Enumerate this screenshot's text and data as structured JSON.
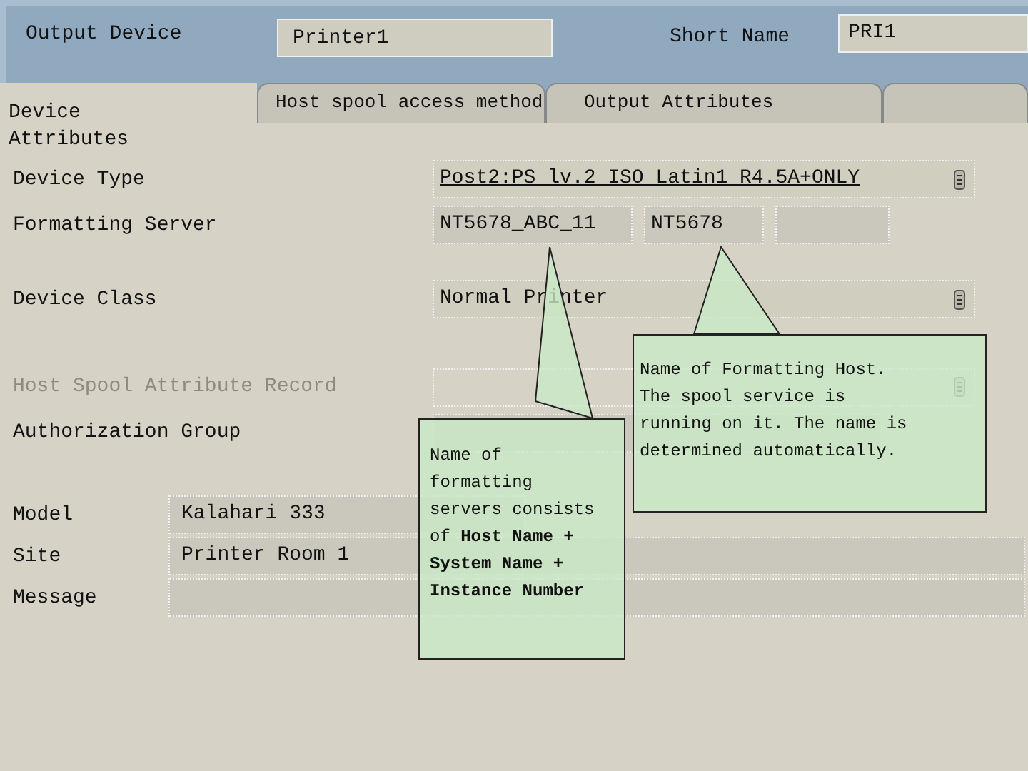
{
  "header": {
    "output_device_label": "Output Device",
    "output_device_value": "Printer1",
    "short_name_label": "Short Name",
    "short_name_value": "PRI1"
  },
  "tabs": [
    {
      "label": "Device Attributes",
      "selected": true
    },
    {
      "label": "Host spool access method",
      "selected": false
    },
    {
      "label": "Output Attributes",
      "selected": false
    }
  ],
  "attributes": [
    {
      "kind": "dropdown",
      "label": "Device Type",
      "values": [
        "Post2:PS lv.2 ISO Latin1 R4.5A+ONLY"
      ],
      "disabled": false
    },
    {
      "kind": "group",
      "label": "Formatting Server",
      "values": [
        "NT5678_ABC_11",
        "NT5678"
      ],
      "disabled": false
    },
    {
      "kind": "dropdown",
      "label": "Device Class",
      "values": [
        "Normal Printer"
      ],
      "disabled": false
    },
    {
      "kind": "dropdown",
      "label": "Host Spool Attribute Record",
      "disabled": true
    },
    {
      "kind": "text",
      "label": "Authorization Group",
      "disabled": false
    }
  ],
  "location": [
    {
      "kind": "short",
      "label": "Model",
      "values": [
        "Kalahari 333"
      ]
    },
    {
      "kind": "long",
      "label": "Site",
      "values": [
        "Printer Room 1"
      ]
    },
    {
      "kind": "long",
      "label": "Message"
    }
  ],
  "callouts": [
    {
      "text": "Name of formatting servers consists of **Host Name + System Name + Instance Number**"
    },
    {
      "text": "Name of Formatting Host. The spool service is running on it. The name is determined automatically."
    }
  ]
}
